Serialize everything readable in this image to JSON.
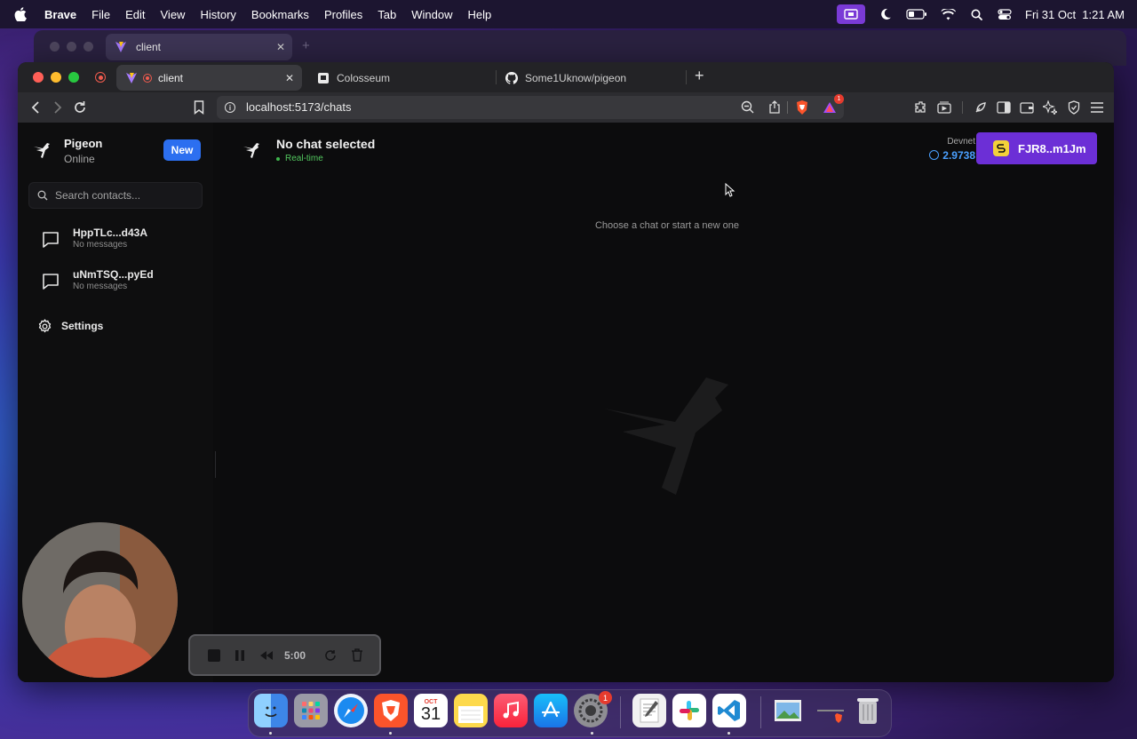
{
  "menubar": {
    "items": [
      "Brave",
      "File",
      "Edit",
      "View",
      "History",
      "Bookmarks",
      "Profiles",
      "Tab",
      "Window",
      "Help"
    ],
    "datetime": "Fri 31 Oct  1:21 AM"
  },
  "background_window": {
    "tab_title": "client"
  },
  "browser": {
    "tabs": [
      {
        "title": "client"
      },
      {
        "title": "Colosseum"
      },
      {
        "title": "Some1Uknow/pigeon"
      }
    ],
    "url": "localhost:5173/chats",
    "notification_count": "1"
  },
  "sidebar": {
    "app_name": "Pigeon",
    "status": "Online",
    "new_button": "New",
    "search_placeholder": "Search contacts...",
    "contacts": [
      {
        "name": "HppTLc...d43A",
        "subtitle": "No messages"
      },
      {
        "name": "uNmTSQ...pyEd",
        "subtitle": "No messages"
      }
    ],
    "settings_label": "Settings"
  },
  "chat": {
    "title": "No chat selected",
    "status": "Real-time",
    "network": "Devnet",
    "balance": "2.9738",
    "wallet": "FJR8..m1Jm",
    "empty_message": "Choose a chat or start a new one"
  },
  "recorder": {
    "time": "5:00"
  },
  "dock": {
    "calendar_month": "OCT",
    "calendar_day": "31",
    "badge": "1"
  },
  "colors": {
    "accent_blue": "#2c6ff0",
    "wallet_purple": "#6c2fd6",
    "realtime_green": "#53c85f",
    "balance_blue": "#4aa0ff"
  }
}
